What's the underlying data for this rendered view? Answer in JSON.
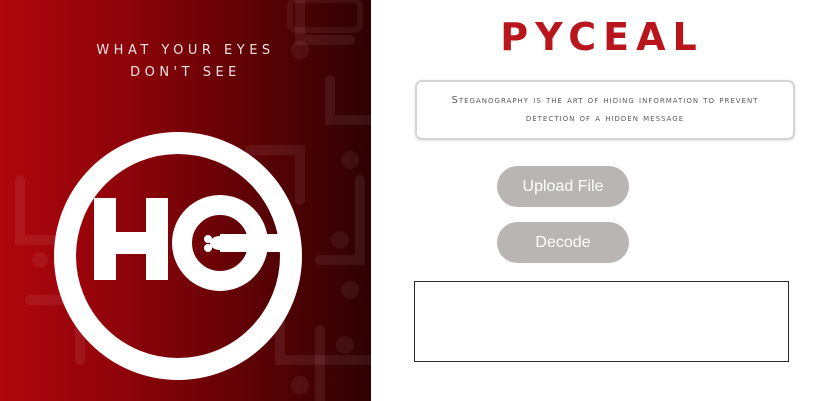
{
  "left": {
    "tagline_line1": "WHAT YOUR EYES",
    "tagline_line2": "DON'T SEE",
    "logo_icon": "hc-logo-icon"
  },
  "right": {
    "title": "PYCEAL",
    "description": "Steganography is the art of hiding information to prevent detection of a hidden message",
    "upload_label": "Upload File",
    "decode_label": "Decode",
    "output_value": ""
  },
  "colors": {
    "brand_red": "#b8161c",
    "button_gray": "#b9b5b5",
    "panel_dark": "#2e0103"
  }
}
